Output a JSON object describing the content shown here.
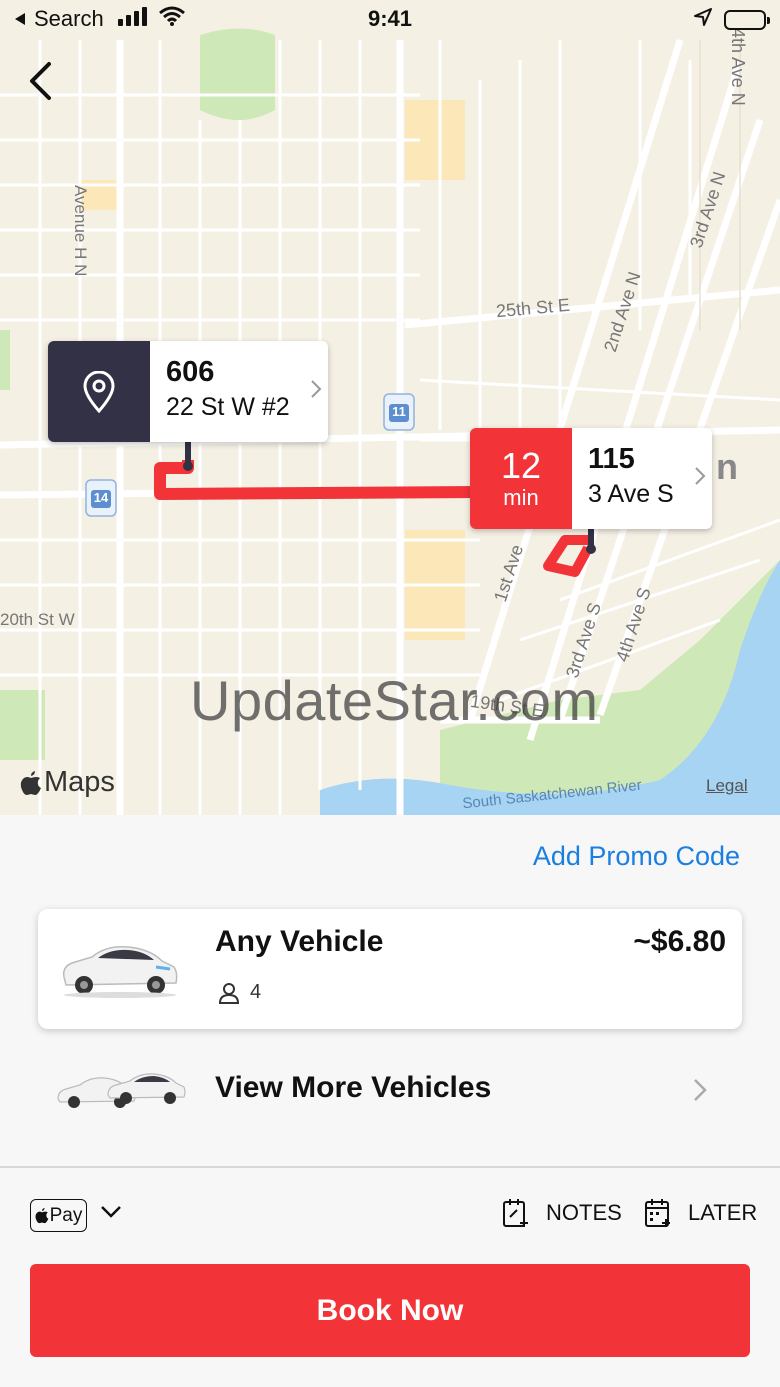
{
  "status_bar": {
    "back_label": "Search",
    "time": "9:41"
  },
  "map": {
    "street_labels": [
      "Avenue H N",
      "25th St E",
      "2nd Ave N",
      "3rd Ave N",
      "4th Ave N",
      "1st Ave",
      "3rd Ave S",
      "4th Ave S",
      "20th St W",
      "19th St E",
      "South Saskatchewan River"
    ],
    "highway_shields": [
      "11",
      "14"
    ],
    "brand": "Maps",
    "legal": "Legal",
    "watermark": "UpdateStar.com",
    "partial_label": "n"
  },
  "pickup": {
    "icon": "location-pin-icon",
    "number": "606",
    "address": "22 St W #2"
  },
  "destination": {
    "eta_value": "12",
    "eta_unit": "min",
    "number": "115",
    "address": "3 Ave S"
  },
  "sheet": {
    "promo_label": "Add Promo Code",
    "vehicle": {
      "name": "Any Vehicle",
      "seats": "4",
      "price": "~$6.80"
    },
    "more_vehicles_label": "View More Vehicles",
    "payment_label": "Pay",
    "notes_label": "NOTES",
    "later_label": "LATER",
    "book_label": "Book Now"
  },
  "colors": {
    "accent_red": "#f23338",
    "pin_dark": "#323145",
    "link_blue": "#1a7fe0"
  }
}
